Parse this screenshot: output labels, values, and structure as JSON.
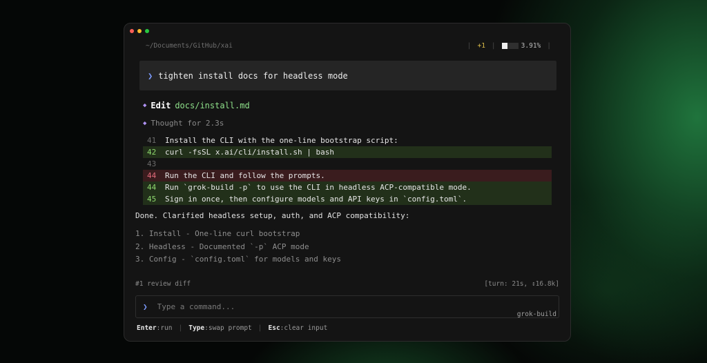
{
  "window": {
    "path": "~/Documents/GitHub/xai",
    "status": {
      "diff_count": "+1",
      "context_percent": "3.91%",
      "context_fraction": 0.0391
    }
  },
  "prompt": {
    "chevron": "❯",
    "text": "tighten install docs for headless mode"
  },
  "edit": {
    "verb": "Edit",
    "file": "docs/install.md"
  },
  "thought": {
    "text": "Thought for 2.3s"
  },
  "diff": [
    {
      "line": "41",
      "kind": "context",
      "text": "Install the CLI with the one-line bootstrap script:"
    },
    {
      "line": "42",
      "kind": "add",
      "text": "curl -fsSL x.ai/cli/install.sh | bash"
    },
    {
      "line": "43",
      "kind": "context",
      "text": ""
    },
    {
      "line": "44",
      "kind": "del",
      "text": "Run the CLI and follow the prompts."
    },
    {
      "line": "44",
      "kind": "add",
      "text": "Run `grok-build -p` to use the CLI in headless ACP-compatible mode."
    },
    {
      "line": "45",
      "kind": "add",
      "text": "Sign in once, then configure models and API keys in `config.toml`."
    }
  ],
  "summary": {
    "done": "Done. Clarified headless setup, auth, and ACP compatibility:",
    "items": [
      "1. Install - One-line curl bootstrap",
      "2. Headless - Documented `-p` ACP mode",
      "3. Config - `config.toml` for models and keys"
    ]
  },
  "footer": {
    "review": "#1 review diff",
    "turn": "[turn: 21s, ↕16.8k]"
  },
  "input": {
    "chevron": "❯",
    "placeholder": "Type a command...",
    "model": "grok-build"
  },
  "hints": [
    {
      "key": "Enter",
      "action": ":run"
    },
    {
      "key": "Type",
      "action": ":swap prompt"
    },
    {
      "key": "Esc",
      "action": ":clear input"
    }
  ],
  "colors": {
    "accent": "#7d9cff",
    "add": "#8ed86e",
    "del": "#e26a7a",
    "diamond": "#b093f5"
  }
}
